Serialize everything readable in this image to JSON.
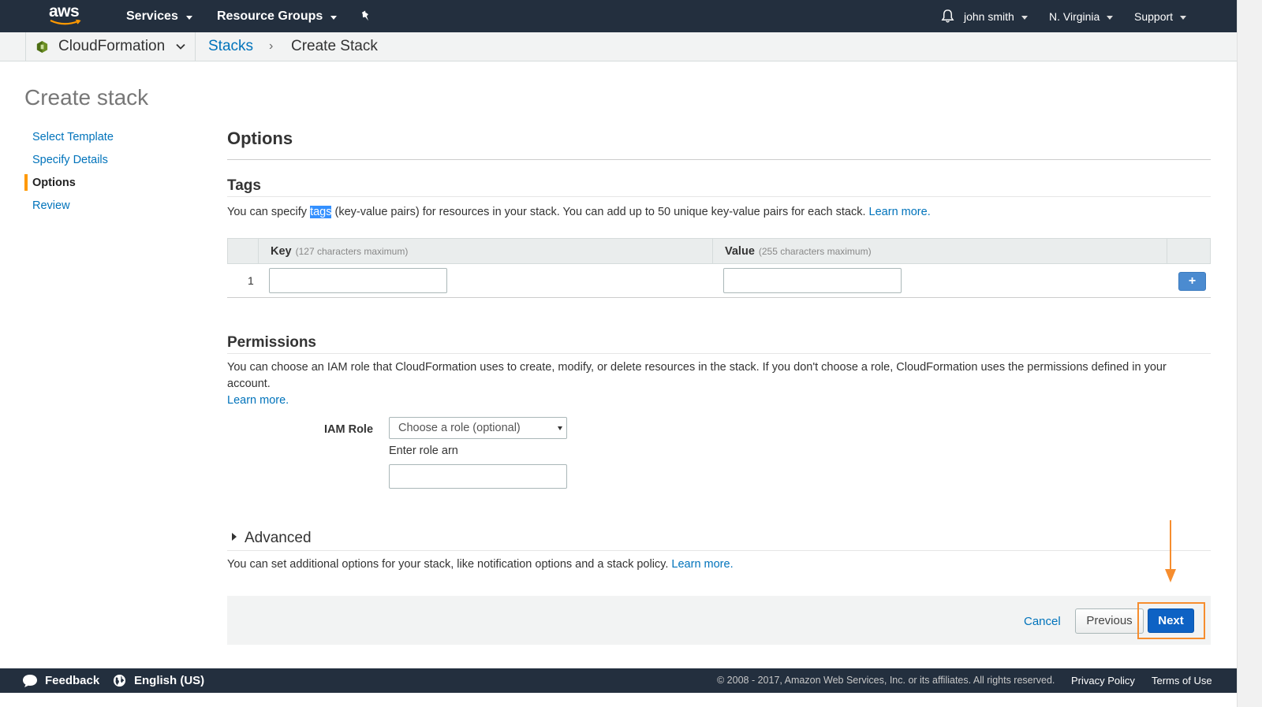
{
  "topnav": {
    "logo": "aws",
    "services": "Services",
    "resource_groups": "Resource Groups",
    "pin_icon": "pin-icon",
    "bell_icon": "bell-icon",
    "user": "john smith",
    "region": "N. Virginia",
    "support": "Support"
  },
  "breadcrumb": {
    "service": "CloudFormation",
    "stacks": "Stacks",
    "separator": "›",
    "current": "Create Stack"
  },
  "page": {
    "title": "Create stack",
    "steps": [
      {
        "label": "Select Template"
      },
      {
        "label": "Specify Details"
      },
      {
        "label": "Options"
      },
      {
        "label": "Review"
      }
    ]
  },
  "options": {
    "heading": "Options",
    "tags": {
      "heading": "Tags",
      "desc_before": "You can specify ",
      "desc_highlight": "tags",
      "desc_after": " (key-value pairs) for resources in your stack. You can add up to 50 unique key-value pairs for each stack. ",
      "learn_more": "Learn more.",
      "key_header": "Key",
      "key_hint": "(127 characters maximum)",
      "value_header": "Value",
      "value_hint": "(255 characters maximum)",
      "row_number": "1",
      "add_label": "+"
    },
    "permissions": {
      "heading": "Permissions",
      "desc": "You can choose an IAM role that CloudFormation uses to create, modify, or delete resources in the stack. If you don't choose a role, CloudFormation uses the permissions defined in your account.",
      "learn_more": "Learn more.",
      "iam_label": "IAM Role",
      "select_value": "Choose a role (optional)",
      "role_arn_label": "Enter role arn"
    },
    "advanced": {
      "heading": "Advanced",
      "desc": "You can set additional options for your stack, like notification options and a stack policy. ",
      "learn_more": "Learn more."
    }
  },
  "actions": {
    "cancel": "Cancel",
    "previous": "Previous",
    "next": "Next"
  },
  "footer": {
    "feedback": "Feedback",
    "language": "English (US)",
    "copyright": "© 2008 - 2017, Amazon Web Services, Inc. or its affiliates. All rights reserved.",
    "privacy": "Privacy Policy",
    "terms": "Terms of Use"
  },
  "colors": {
    "nav_bg": "#232f3e",
    "link": "#0073bb",
    "accent": "#ff9900",
    "primary_button": "#0e62c4",
    "annotation": "#f68d2e"
  }
}
